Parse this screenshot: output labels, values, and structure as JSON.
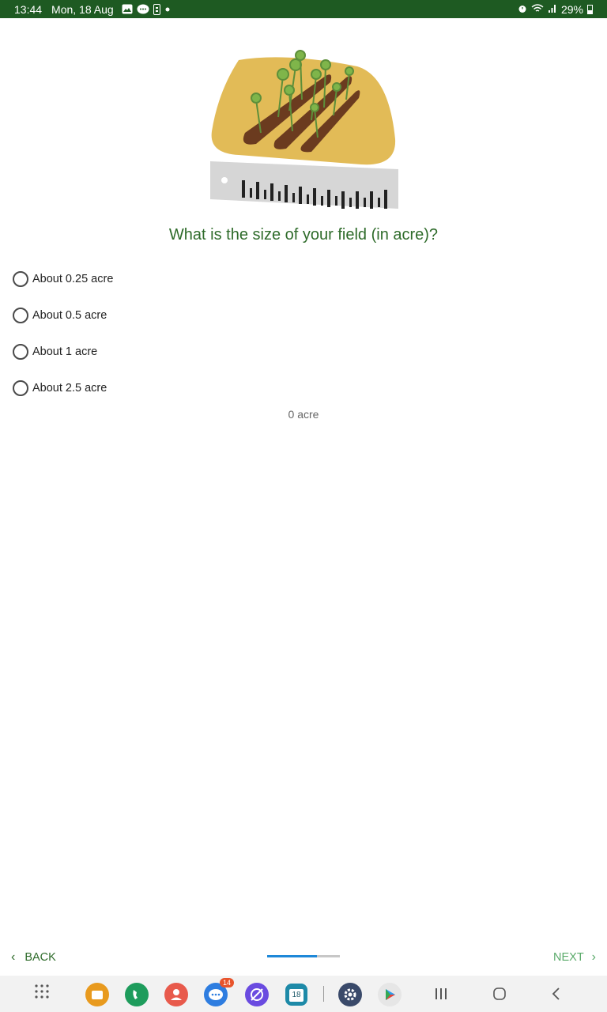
{
  "status_bar": {
    "time": "13:44",
    "date": "Mon, 18 Aug",
    "battery": "29%",
    "icons": [
      "gallery-icon",
      "message-icon",
      "sim-icon",
      "dot-icon",
      "alarm-icon",
      "wifi-icon",
      "signal-icon",
      "battery-icon"
    ]
  },
  "question": "What is the size of your field (in acre)?",
  "options": [
    {
      "label": "About 0.25 acre",
      "selected": false
    },
    {
      "label": "About 0.5 acre",
      "selected": false
    },
    {
      "label": "About 1 acre",
      "selected": false
    },
    {
      "label": "About 2.5 acre",
      "selected": false
    }
  ],
  "value_readout": "0 acre",
  "nav": {
    "back_label": "BACK",
    "next_label": "NEXT",
    "progress_fraction": 0.68
  },
  "system_nav": {
    "apps": [
      "apps-grid-icon",
      "files-icon",
      "phone-icon",
      "contacts-icon",
      "messages-icon",
      "internet-icon",
      "calendar-icon",
      "settings-icon",
      "play-store-icon"
    ],
    "messages_badge": "14",
    "calendar_day": "18"
  },
  "colors": {
    "status_bar": "#1e5a22",
    "question": "#2e6b2a",
    "next": "#5aaa6a",
    "progress": "#1e88d8"
  }
}
